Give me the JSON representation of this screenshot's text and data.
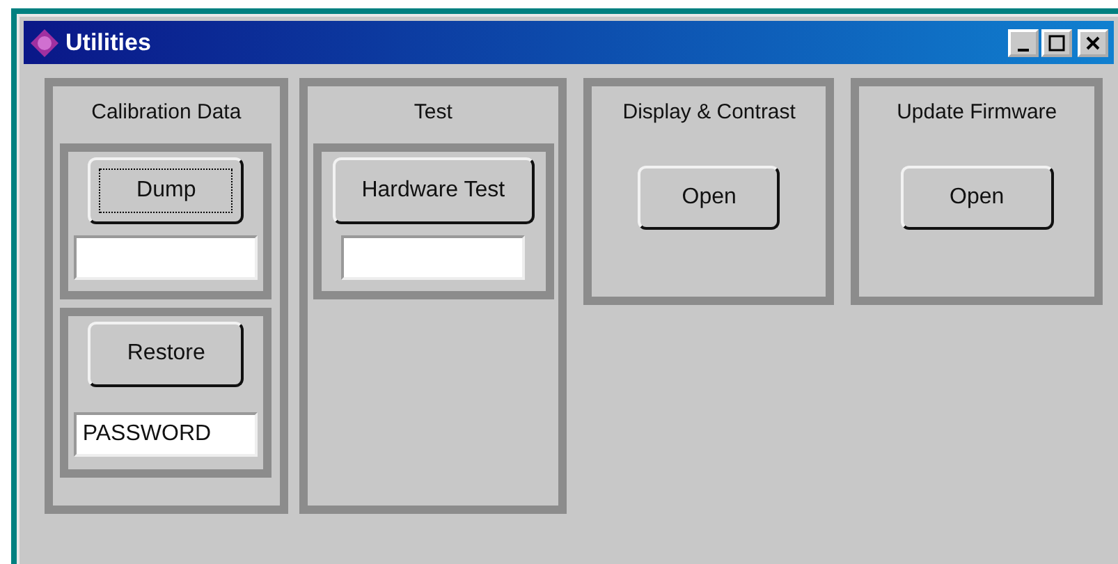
{
  "window": {
    "title": "Utilities"
  },
  "panels": [
    {
      "title": "Calibration Data",
      "items": [
        {
          "kind": "group",
          "button": {
            "label": "Dump",
            "focused": true
          }
        },
        {
          "kind": "group",
          "button": {
            "label": "Restore",
            "focused": false
          },
          "field": {
            "value": "PASSWORD"
          }
        }
      ]
    },
    {
      "title": "Test",
      "items": [
        {
          "kind": "group",
          "button": {
            "label": "Hardware Test",
            "focused": false
          }
        }
      ]
    },
    {
      "title": "Display & Contrast",
      "items": [
        {
          "kind": "button",
          "button": {
            "label": "Open",
            "focused": false
          }
        }
      ]
    },
    {
      "title": "Update Firmware",
      "items": [
        {
          "kind": "button",
          "button": {
            "label": "Open",
            "focused": false
          }
        }
      ]
    }
  ]
}
